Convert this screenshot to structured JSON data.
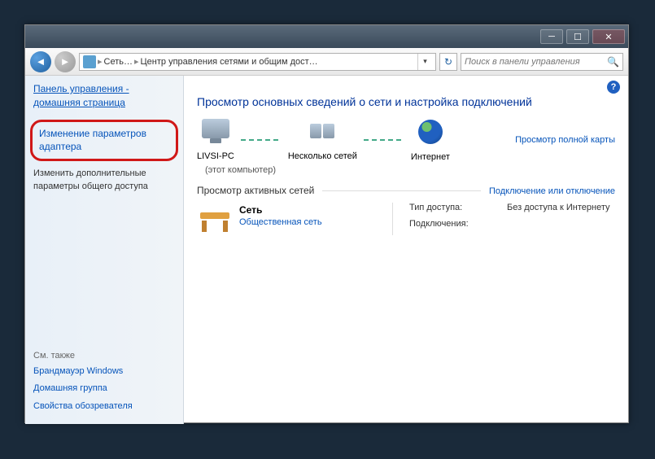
{
  "breadcrumb": {
    "part1": "Сеть…",
    "part2": "Центр управления сетями и общим дост…"
  },
  "search": {
    "placeholder": "Поиск в панели управления"
  },
  "sidebar": {
    "home": "Панель управления - домашняя страница",
    "adapter": "Изменение параметров адаптера",
    "sharing": "Изменить дополнительные параметры общего доступа",
    "seealso_hdr": "См. также",
    "firewall": "Брандмауэр Windows",
    "homegroup": "Домашняя группа",
    "inetopts": "Свойства обозревателя"
  },
  "content": {
    "title": "Просмотр основных сведений о сети и настройка подключений",
    "map_link": "Просмотр полной карты",
    "node_pc": "LIVSI-PC",
    "node_pc_sub": "(этот компьютер)",
    "node_multi": "Несколько сетей",
    "node_internet": "Интернет",
    "active_hdr": "Просмотр активных сетей",
    "active_link": "Подключение или отключение",
    "net_name": "Сеть",
    "net_type": "Общественная сеть",
    "prop_access_lbl": "Тип доступа:",
    "prop_access_val": "Без доступа к Интернету",
    "prop_conn_lbl": "Подключения:"
  }
}
